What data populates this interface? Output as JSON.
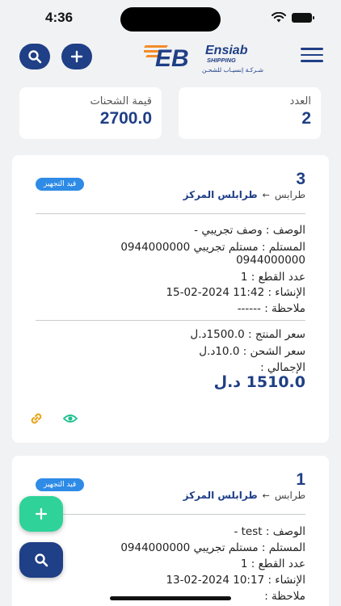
{
  "status_bar": {
    "time": "4:36"
  },
  "header": {
    "logo": {
      "brand": "Ensiab",
      "sub": "SHIPPING",
      "arabic": "شـركـة إنسيـاب للشحـن",
      "mark": "EB"
    }
  },
  "stats": {
    "count_label": "العدد",
    "count_value": "2",
    "shipments_value_label": "قيمة الشحنات",
    "shipments_value": "2700.0"
  },
  "shipments": [
    {
      "number": "3",
      "status": "قيد التجهيز",
      "origin": "طرابس",
      "destination": "طرابلس المركز",
      "description": "الوصف : وصف تجريبي -",
      "receiver": "المستلم : مستلم تجريبي 0944000000",
      "receiver_phone": "0944000000",
      "pieces": "عدد القطع : 1",
      "created": "الإنشاء : 11:42 2024-02-15",
      "note": "ملاحظة : ------",
      "product_price": "سعر المنتج : 1500.0د.ل",
      "shipping_price": "سعر الشحن : 10.0د.ل",
      "total_label": "الإجمالي :",
      "total": "1510.0 د.ل"
    },
    {
      "number": "1",
      "status": "قيد التجهيز",
      "origin": "طرابس",
      "destination": "طرابلس المركز",
      "description": "الوصف : test -",
      "receiver": "المستلم : مستلم تجريبي 0944000000",
      "pieces": "عدد القطع : 1",
      "created": "الإنشاء : 10:17 2024-02-13",
      "note": "ملاحظة :"
    }
  ],
  "colors": {
    "primary": "#1f3f86",
    "accent_green": "#2fd39a",
    "badge_blue": "#2e8be6",
    "logo_orange": "#f28c28"
  }
}
